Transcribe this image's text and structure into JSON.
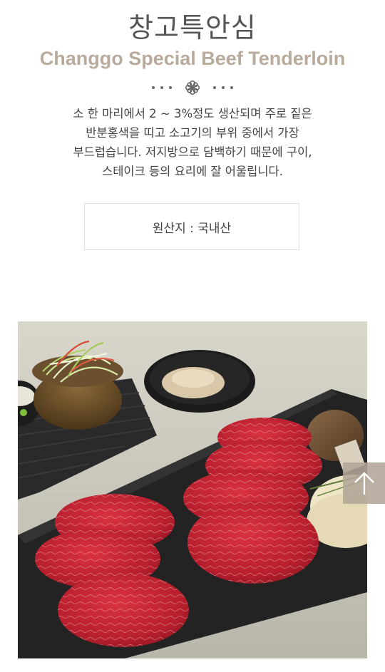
{
  "header": {
    "title_ko": "창고특안심",
    "title_en": "Changgo Special Beef Tenderloin"
  },
  "description": {
    "lines": [
      "소 한 마리에서 2 ~ 3%정도 생산되며 주로 짙은",
      "반분홍색을 띠고 소고기의 부위 중에서 가장",
      "부드럽습니다. 저지방으로 담백하기 때문에 구이,",
      "스테이크 등의 요리에 잘 어울립니다."
    ]
  },
  "origin": {
    "text": "원산지 : 국내산"
  },
  "icons": {
    "divider": "flower-ornament-icon",
    "scroll_top": "arrow-up-icon"
  },
  "colors": {
    "title": "#555555",
    "subtitle": "#b8ab9b",
    "scroll_top_bg": "#b2a596"
  }
}
